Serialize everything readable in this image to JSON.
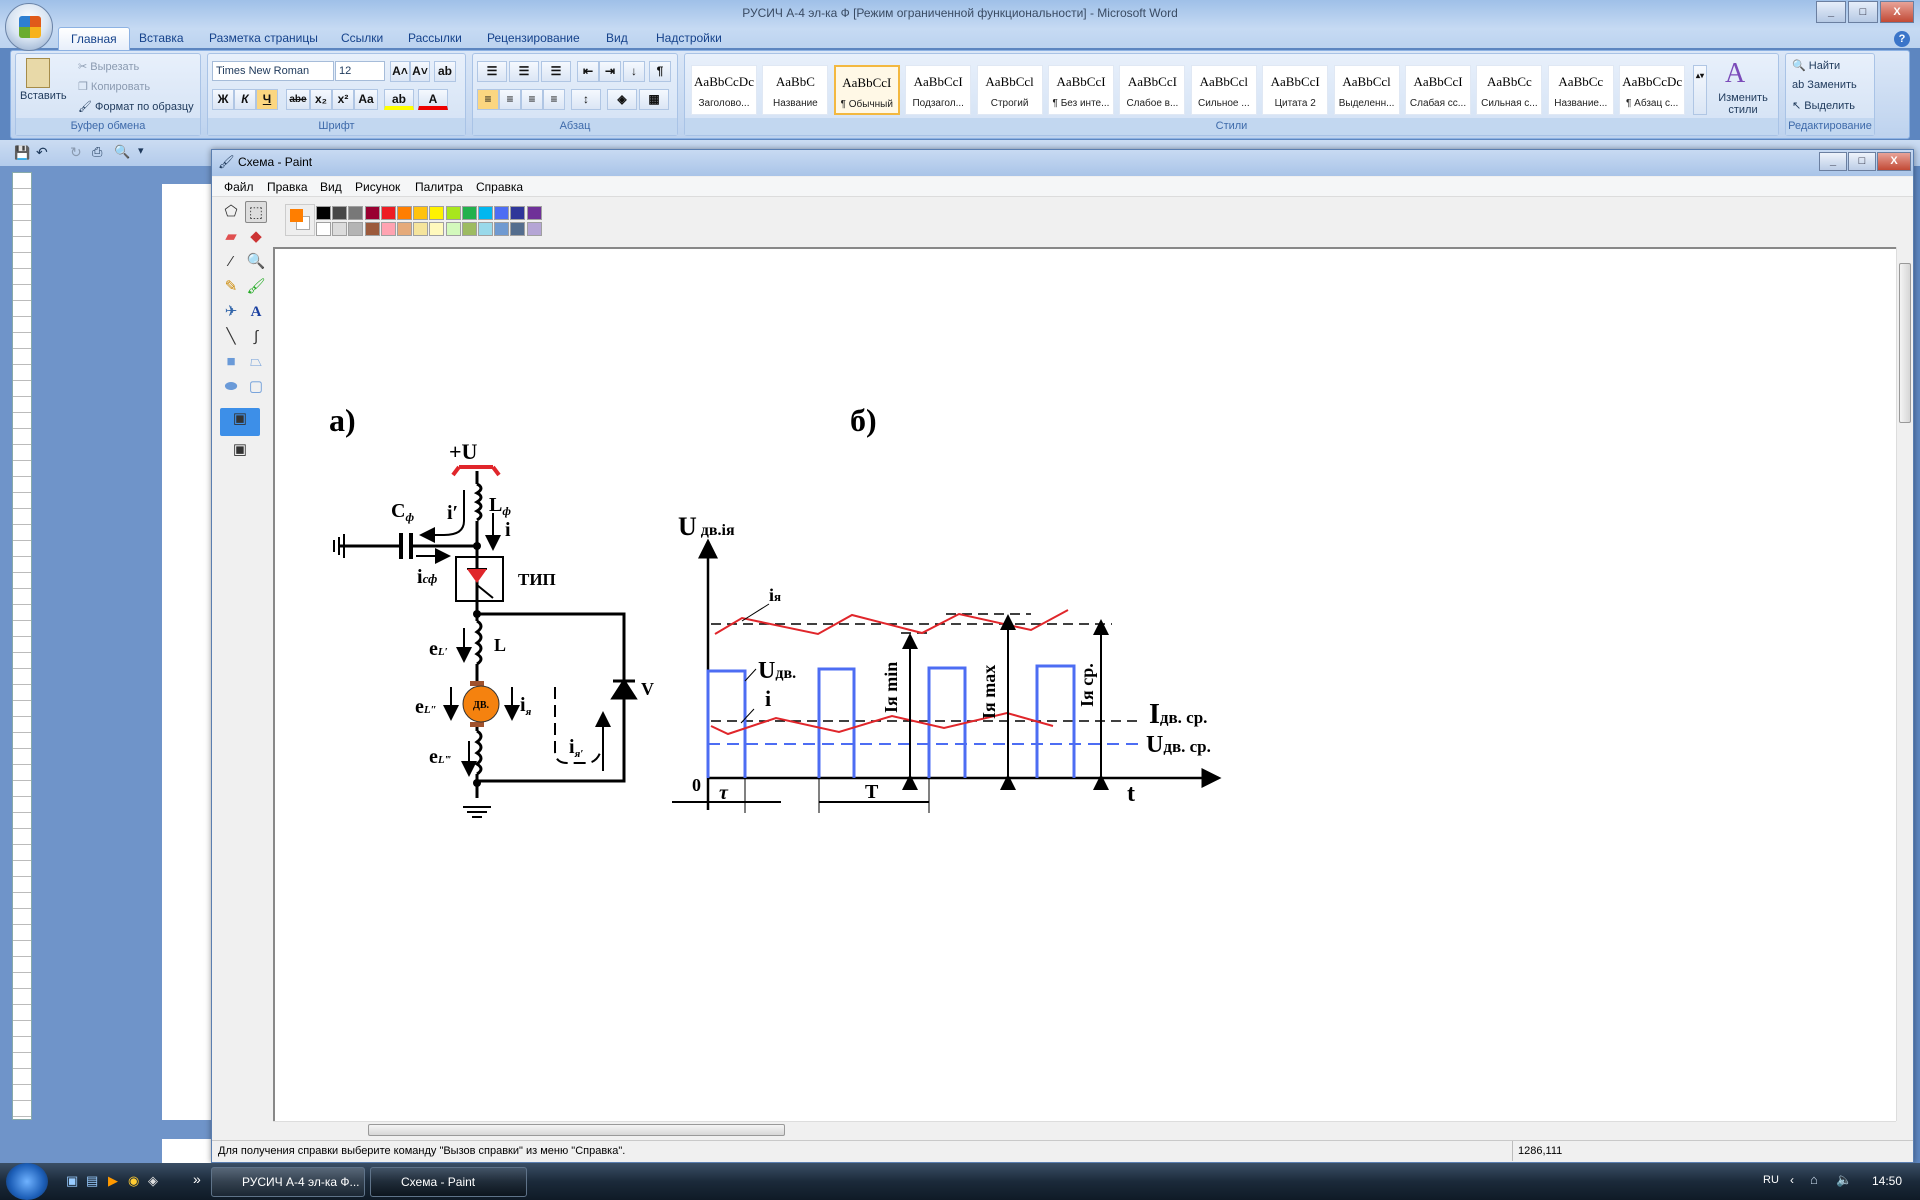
{
  "word": {
    "title": "РУСИЧ А-4 эл-ка Ф [Режим ограниченной функциональности] - Microsoft Word",
    "tabs": [
      "Главная",
      "Вставка",
      "Разметка страницы",
      "Ссылки",
      "Рассылки",
      "Рецензирование",
      "Вид",
      "Надстройки"
    ],
    "help": "?",
    "clipboard": {
      "paste": "Вставить",
      "cut": "Вырезать",
      "copy": "Копировать",
      "format_painter": "Формат по образцу",
      "label": "Буфер обмена"
    },
    "font": {
      "name": "Times New Roman",
      "size": "12",
      "label": "Шрифт",
      "bold": "Ж",
      "italic": "К",
      "underline": "Ч",
      "strike": "abe",
      "sub": "x₂",
      "sup": "x²",
      "case": "Aa",
      "grow": "A˄",
      "shrink": "A˅",
      "color": "A"
    },
    "paragraph": {
      "label": "Абзац",
      "pilcrow": "¶"
    },
    "styles": {
      "label": "Стили",
      "change": "Изменить стили",
      "items": [
        {
          "preview": "AaBbCcDc",
          "name": "Заголово..."
        },
        {
          "preview": "AaBbC",
          "name": "Название"
        },
        {
          "preview": "AaBbCcI",
          "name": "¶ Обычный"
        },
        {
          "preview": "AaBbCcI",
          "name": "Подзагол..."
        },
        {
          "preview": "AaBbCcl",
          "name": "Строгий"
        },
        {
          "preview": "AaBbCcI",
          "name": "¶ Без инте..."
        },
        {
          "preview": "AaBbCcI",
          "name": "Слабое в..."
        },
        {
          "preview": "AaBbCcl",
          "name": "Сильное ..."
        },
        {
          "preview": "AaBbCcI",
          "name": "Цитата 2"
        },
        {
          "preview": "AaBbCcl",
          "name": "Выделенн..."
        },
        {
          "preview": "AaBbCcI",
          "name": "Слабая сс..."
        },
        {
          "preview": "AaBbCc",
          "name": "Сильная с..."
        },
        {
          "preview": "AaBbCc",
          "name": "Название..."
        },
        {
          "preview": "AaBbCcDc",
          "name": "¶ Абзац с..."
        }
      ],
      "selected": "¶ Обычный"
    },
    "editing": {
      "find": "Найти",
      "replace": "Заменить",
      "select": "Выделить",
      "label": "Редактирование"
    }
  },
  "paint": {
    "title": "Схема - Paint",
    "menu": [
      "Файл",
      "Правка",
      "Вид",
      "Рисунок",
      "Палитра",
      "Справка"
    ],
    "current_color": "#ff7e00",
    "palette": [
      "#000000",
      "#464646",
      "#787878",
      "#990030",
      "#ed1c24",
      "#ff7e00",
      "#ffc20e",
      "#fff200",
      "#a8e61d",
      "#22b14c",
      "#00b7ef",
      "#4d6df3",
      "#2f3699",
      "#6f3198",
      "#ffffff",
      "#dcdcdc",
      "#b4b4b4",
      "#9c5a3c",
      "#ffa3b1",
      "#e5aa7a",
      "#f5e49c",
      "#fff9bd",
      "#d3f9bc",
      "#9dbb61",
      "#99d9ea",
      "#709ad1",
      "#546d8e",
      "#b5a5d5"
    ],
    "status": "Для получения справки выберите команду \"Вызов справки\" из меню \"Справка\".",
    "coords": "1286,111"
  },
  "drawing": {
    "part_a": "а)",
    "part_b": "б)",
    "supply": "+U",
    "cf": "C",
    "cf_sub": "ф",
    "i_prime": "i′",
    "lf": "L",
    "lf_sub": "ф",
    "i": "i",
    "icf": "i",
    "icf_sub": "сф",
    "tip": "ТИП",
    "el1": "e",
    "el1_sub": "L′",
    "l": "L",
    "el2": "e",
    "el2_sub": "L″",
    "motor": "ДВ.",
    "ia": "i",
    "ia_sub": "я",
    "el3": "e",
    "el3_sub": "L‴",
    "ia2": "i",
    "ia2_sub": "я′",
    "diode": "V",
    "axis_y": "U",
    "axis_y_sub": "дв.iя",
    "origin": "0",
    "axis_x": "t",
    "tau": "τ",
    "period": "T",
    "ia_curve": "i",
    "ia_curve_sub": "я",
    "u_curve": "U",
    "u_curve_sub": "дв.",
    "i_curve": "i",
    "imin": "Iя min",
    "imax": "Iя max",
    "iavg": "Iя ср.",
    "i_dv_avg": "I",
    "i_dv_avg_sub": "дв. ср.",
    "u_dv_avg": "U",
    "u_dv_avg_sub": "дв. ср.",
    "colors": {
      "voltage": "#4d6df3",
      "current": "#e0262b",
      "motor": "#f5820f"
    }
  },
  "taskbar": {
    "word_task": "РУСИЧ А-4 эл-ка Ф...",
    "paint_task": "Схема - Paint",
    "lang": "RU",
    "time": "14:50",
    "more": "»"
  }
}
